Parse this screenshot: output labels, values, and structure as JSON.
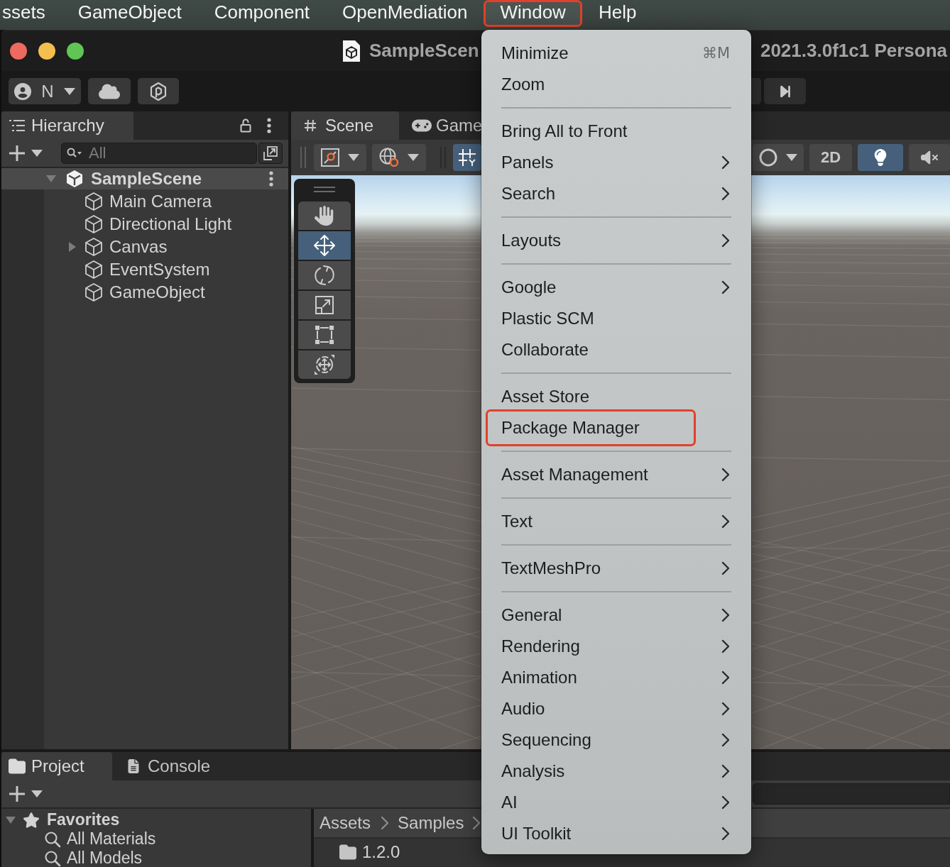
{
  "menu_bar": {
    "items": [
      {
        "label": "ssets",
        "selected": false,
        "outlined": false
      },
      {
        "label": "GameObject",
        "selected": false,
        "outlined": false
      },
      {
        "label": "Component",
        "selected": false,
        "outlined": false
      },
      {
        "label": "OpenMediation",
        "selected": false,
        "outlined": false
      },
      {
        "label": "Window",
        "selected": true,
        "outlined": true
      },
      {
        "label": "Help",
        "selected": false,
        "outlined": false
      }
    ]
  },
  "window": {
    "title_left": "SampleScen",
    "title_right": "2021.3.0f1c1 Persona"
  },
  "toolbar": {
    "account_label": "N"
  },
  "hierarchy": {
    "tab": {
      "label": "Hierarchy",
      "selected": true
    },
    "search": {
      "placeholder": "All"
    },
    "items": [
      {
        "label": "SampleScene",
        "kind": "scene",
        "expanded": true,
        "children": [
          {
            "label": "Main Camera",
            "kind": "object"
          },
          {
            "label": "Directional Light",
            "kind": "object"
          },
          {
            "label": "Canvas",
            "kind": "object",
            "expanded": false
          },
          {
            "label": "EventSystem",
            "kind": "object"
          },
          {
            "label": "GameObject",
            "kind": "object"
          }
        ]
      }
    ]
  },
  "scene": {
    "tabs": [
      {
        "label": "Scene",
        "kind": "scene",
        "selected": true
      },
      {
        "label": "Game",
        "kind": "game",
        "selected": false
      }
    ],
    "grid_snapping": {
      "on": true
    },
    "toggle_2d": {
      "label": "2D",
      "on": false
    },
    "lighting": {
      "on": true
    },
    "audio": {
      "on": false
    },
    "tools": [
      {
        "kind": "hand",
        "selected": false
      },
      {
        "kind": "move",
        "selected": true
      },
      {
        "kind": "rotate",
        "selected": false
      },
      {
        "kind": "scale",
        "selected": false
      },
      {
        "kind": "rect",
        "selected": false
      },
      {
        "kind": "transform",
        "selected": false
      }
    ]
  },
  "project": {
    "tabs": [
      {
        "label": "Project",
        "kind": "project",
        "selected": true
      },
      {
        "label": "Console",
        "kind": "console",
        "selected": false
      }
    ],
    "favorites": [
      {
        "label": "Favorites",
        "expanded": true,
        "children": [
          {
            "label": "All Materials"
          },
          {
            "label": "All Models"
          }
        ]
      }
    ],
    "breadcrumb": [
      "Assets",
      "Samples"
    ],
    "items": [
      {
        "label": "1.2.0",
        "kind": "folder"
      }
    ]
  },
  "window_menu": {
    "items": [
      {
        "kind": "item",
        "label": "Minimize",
        "shortcut": "⌘M",
        "submenu": false,
        "outlined": false
      },
      {
        "kind": "item",
        "label": "Zoom",
        "submenu": false,
        "outlined": false
      },
      {
        "kind": "separator"
      },
      {
        "kind": "item",
        "label": "Bring All to Front",
        "submenu": false,
        "outlined": false
      },
      {
        "kind": "item",
        "label": "Panels",
        "submenu": true,
        "outlined": false
      },
      {
        "kind": "item",
        "label": "Search",
        "submenu": true,
        "outlined": false
      },
      {
        "kind": "separator"
      },
      {
        "kind": "item",
        "label": "Layouts",
        "submenu": true,
        "outlined": false
      },
      {
        "kind": "separator"
      },
      {
        "kind": "item",
        "label": "Google",
        "submenu": true,
        "outlined": false
      },
      {
        "kind": "item",
        "label": "Plastic SCM",
        "submenu": false,
        "outlined": false
      },
      {
        "kind": "item",
        "label": "Collaborate",
        "submenu": false,
        "outlined": false
      },
      {
        "kind": "separator"
      },
      {
        "kind": "item",
        "label": "Asset Store",
        "submenu": false,
        "outlined": false
      },
      {
        "kind": "item",
        "label": "Package Manager",
        "submenu": false,
        "outlined": true
      },
      {
        "kind": "separator"
      },
      {
        "kind": "item",
        "label": "Asset Management",
        "submenu": true,
        "outlined": false
      },
      {
        "kind": "separator"
      },
      {
        "kind": "item",
        "label": "Text",
        "submenu": true,
        "outlined": false
      },
      {
        "kind": "separator"
      },
      {
        "kind": "item",
        "label": "TextMeshPro",
        "submenu": true,
        "outlined": false
      },
      {
        "kind": "separator"
      },
      {
        "kind": "item",
        "label": "General",
        "submenu": true,
        "outlined": false
      },
      {
        "kind": "item",
        "label": "Rendering",
        "submenu": true,
        "outlined": false
      },
      {
        "kind": "item",
        "label": "Animation",
        "submenu": true,
        "outlined": false
      },
      {
        "kind": "item",
        "label": "Audio",
        "submenu": true,
        "outlined": false
      },
      {
        "kind": "item",
        "label": "Sequencing",
        "submenu": true,
        "outlined": false
      },
      {
        "kind": "item",
        "label": "Analysis",
        "submenu": true,
        "outlined": false
      },
      {
        "kind": "item",
        "label": "AI",
        "submenu": true,
        "outlined": false
      },
      {
        "kind": "item",
        "label": "UI Toolkit",
        "submenu": true,
        "outlined": false
      }
    ]
  }
}
